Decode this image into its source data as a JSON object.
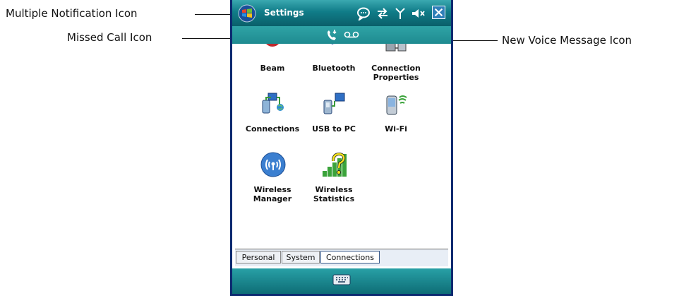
{
  "callouts": {
    "multiple_notification": "Multiple Notification Icon",
    "missed_call": "Missed Call Icon",
    "new_voice_message": "New Voice Message Icon"
  },
  "titlebar": {
    "title": "Settings",
    "icons": [
      "windows-start-icon",
      "notification-bubble-icon",
      "sync-arrows-icon",
      "signal-antenna-icon",
      "speaker-muted-icon",
      "close-icon"
    ]
  },
  "notification_bar": {
    "icons": [
      "missed-call-icon",
      "voicemail-icon"
    ]
  },
  "settings_items": [
    {
      "label": "Beam",
      "icon": "beam-icon"
    },
    {
      "label": "Bluetooth",
      "icon": "bluetooth-icon"
    },
    {
      "label": "Connection Properties",
      "label_lines": [
        "Connection",
        "Properties"
      ],
      "icon": "connection-properties-icon"
    },
    {
      "label": "Connections",
      "icon": "connections-icon"
    },
    {
      "label": "USB to PC",
      "icon": "usb-to-pc-icon"
    },
    {
      "label": "Wi-Fi",
      "icon": "wifi-icon"
    },
    {
      "label": "Wireless Manager",
      "label_lines": [
        "Wireless",
        "Manager"
      ],
      "icon": "wireless-manager-icon"
    },
    {
      "label": "Wireless Statistics",
      "label_lines": [
        "Wireless",
        "Statistics"
      ],
      "icon": "wireless-statistics-icon"
    }
  ],
  "tabs": [
    {
      "label": "Personal",
      "active": false
    },
    {
      "label": "System",
      "active": false
    },
    {
      "label": "Connections",
      "active": true
    }
  ],
  "softbar": {
    "icons": [
      "keyboard-icon"
    ]
  },
  "colors": {
    "titlebar": "#107c88",
    "frame": "#0c2a70",
    "tab_active": "#ffffff"
  }
}
